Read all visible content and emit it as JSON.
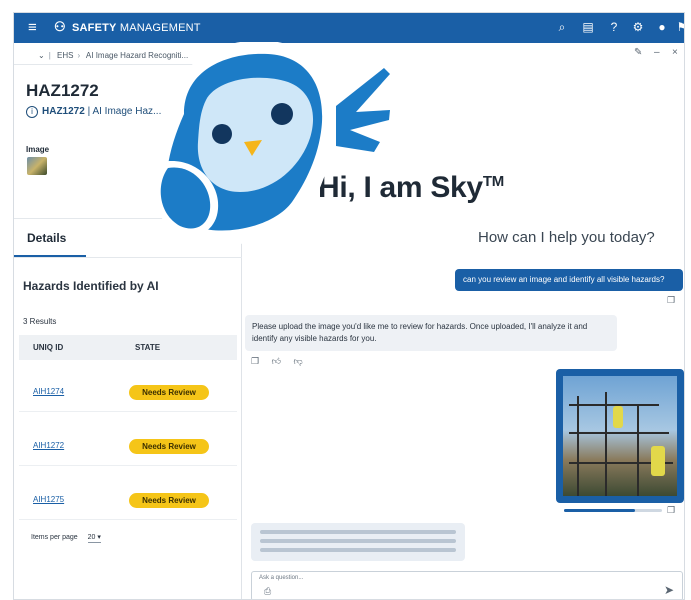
{
  "topbar": {
    "menu_icon": "hamburger-icon",
    "brand_icon": "people-icon",
    "title_bold": "SAFETY",
    "title_rest": " MANAGEMENT",
    "icons": [
      "search-icon",
      "document-icon",
      "help-icon",
      "settings-icon",
      "user-icon",
      "flag-icon"
    ]
  },
  "breadcrumb": {
    "items": [
      "EHS",
      "AI Image Hazard Recogniti..."
    ]
  },
  "record": {
    "title": "HAZ1272",
    "id": "HAZ1272",
    "separator": "|",
    "type": "AI Image Haz...",
    "image_label": "Image"
  },
  "tabs": {
    "details": "Details"
  },
  "hazards": {
    "heading": "Hazards Identified by AI",
    "results": "3 Results",
    "col_id": "UNIQ ID",
    "col_state": "STATE",
    "rows": [
      {
        "id": "AIH1274",
        "state": "Needs Review"
      },
      {
        "id": "AIH1272",
        "state": "Needs Review"
      },
      {
        "id": "AIH1275",
        "state": "Needs Review"
      }
    ],
    "pager_label": "Items per page",
    "pager_value": "20"
  },
  "chat": {
    "greeting": "Hi, I am Sky",
    "tm": "TM",
    "prompt": "How can I help you today?",
    "user_message": "can you review an image and identify all visible hazards?",
    "bot_message": "Please upload the image you'd like me to review for hazards. Once uploaded, I'll analyze it and identify any visible hazards for you.",
    "input_placeholder": "Ask a question...",
    "upload_progress": 0.72
  },
  "colors": {
    "brand_blue": "#1a5fa6",
    "badge_yellow": "#f5c518",
    "mascot_blue": "#1c7cc7",
    "mascot_light": "#cfe7f8"
  }
}
